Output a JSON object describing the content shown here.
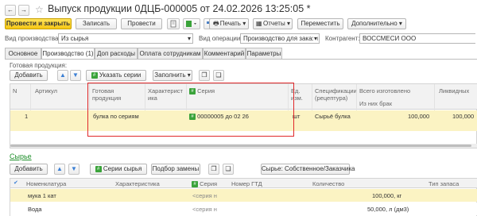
{
  "window": {
    "title": "Выпуск продукции 0ДЦБ-000005 от 24.02.2026 13:25:05 *",
    "nav_back": "←",
    "nav_fwd": "→",
    "star": "☆"
  },
  "toolbar": {
    "post_close": "Провести и закрыть",
    "save": "Записать",
    "post": "Провести",
    "print": "Печать",
    "reports": "Отчеты",
    "move": "Переместить",
    "more": "Дополнительно"
  },
  "fields": {
    "prod_type_label": "Вид производства:",
    "prod_type_value": "Из сырья",
    "op_type_label": "Вид операции:",
    "op_type_value": "Производство для заказч",
    "counterparty_label": "Контрагент:",
    "counterparty_value": "ВОССМЕСИ ООО"
  },
  "tabs": [
    "Основное",
    "Производство (1)",
    "Доп расходы",
    "Оплата сотрудникам",
    "Комментарий",
    "Параметры"
  ],
  "production": {
    "section_label": "Готовая продукция:",
    "add": "Добавить",
    "show_series": "Указать серии",
    "fill": "Заполнить",
    "columns": {
      "n": "N",
      "article": "Артикул",
      "product": "Готовая продукция",
      "characteristic": "Характерист ика",
      "series": "Серия",
      "unit": "Ед. изм.",
      "spec": "Спецификации (рецептура)",
      "total_made": "Всего изготовлено",
      "from_defect": "Из них брак",
      "liquid": "Ликвидных"
    },
    "rows": [
      {
        "n": "1",
        "product": "булка по сериям",
        "series": "00000005 до 02 26",
        "unit": "шт",
        "spec": "Сырьё булка",
        "total": "100,000",
        "liquid": "100,000"
      }
    ]
  },
  "raw": {
    "title": "Сырье",
    "add": "Добавить",
    "series_raw": "Серии сырья",
    "replace": "Подбор замены",
    "raw_filter": "Сырье: Собственное/Заказчика",
    "columns": {
      "nomenclature": "Номенклатура",
      "characteristic": "Характеристика",
      "series": "Серия",
      "gtd": "Номер ГТД",
      "qty": "Количество",
      "stock_type": "Тип запаса"
    },
    "rows": [
      {
        "name": "мука 1 кат",
        "series": "<серия н",
        "qty": "100,000, кг"
      },
      {
        "name": "Вода",
        "series": "<серия н",
        "qty": "50,000, л (дм3)"
      }
    ]
  },
  "colors": {
    "accent_yellow": "#f6c715",
    "selected_row": "#fbf3c3",
    "highlight_border": "#e0282a",
    "green": "#3aa33a",
    "link_green": "#1f8f2b"
  }
}
